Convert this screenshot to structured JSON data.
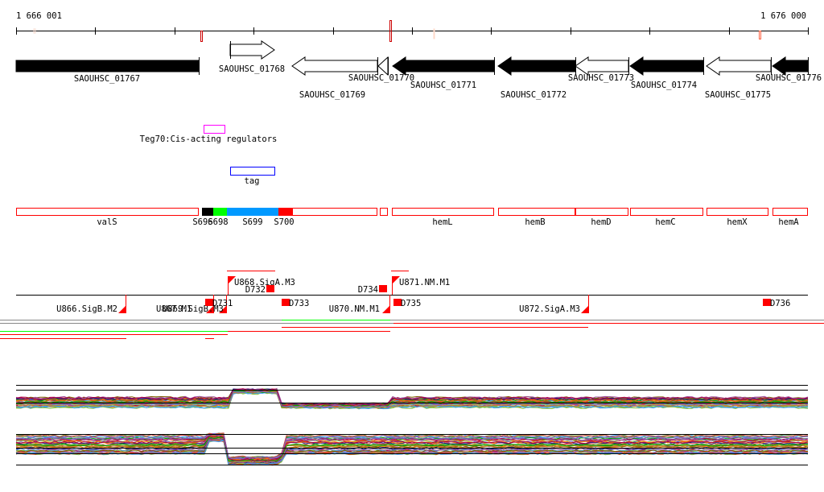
{
  "ruler": {
    "start_label": "1 666 001",
    "end_label": "1 676 000"
  },
  "genes": [
    {
      "label": "SAOUHSC_01767",
      "strand": "none",
      "fill": "filled"
    },
    {
      "label": "SAOUHSC_01768",
      "strand": "+",
      "fill": "outline"
    },
    {
      "label": "SAOUHSC_01769",
      "strand": "-",
      "fill": "outline"
    },
    {
      "label": "SAOUHSC_01770",
      "strand": "-",
      "fill": "outline"
    },
    {
      "label": "SAOUHSC_01771",
      "strand": "-",
      "fill": "filled"
    },
    {
      "label": "SAOUHSC_01772",
      "strand": "-",
      "fill": "filled"
    },
    {
      "label": "SAOUHSC_01773",
      "strand": "-",
      "fill": "outline"
    },
    {
      "label": "SAOUHSC_01774",
      "strand": "-",
      "fill": "filled"
    },
    {
      "label": "SAOUHSC_01775",
      "strand": "-",
      "fill": "outline"
    },
    {
      "label": "SAOUHSC_01776",
      "strand": "-",
      "fill": "filled"
    }
  ],
  "regulator": {
    "label": "Teg70:Cis-acting regulators",
    "color": "#ff00ff"
  },
  "tag": {
    "label": "tag",
    "color": "#0000ff"
  },
  "features": [
    {
      "label": "valS",
      "color": "#ff0000",
      "filled": false
    },
    {
      "label": "S696",
      "color": "#000000",
      "filled": true
    },
    {
      "label": "S698",
      "color": "#00ff00",
      "filled": true
    },
    {
      "label": "S699",
      "color": "#0099ff",
      "filled": true
    },
    {
      "label": "S700",
      "color": "#ff0000",
      "filled": true
    },
    {
      "label": "",
      "color": "#ff0000",
      "filled": false
    },
    {
      "label": "",
      "color": "#ff0000",
      "filled": false
    },
    {
      "label": "hemL",
      "color": "#ff0000",
      "filled": false
    },
    {
      "label": "hemB",
      "color": "#ff0000",
      "filled": false
    },
    {
      "label": "hemD",
      "color": "#ff0000",
      "filled": false
    },
    {
      "label": "hemC",
      "color": "#ff0000",
      "filled": false
    },
    {
      "label": "hemX",
      "color": "#ff0000",
      "filled": false
    },
    {
      "label": "hemA",
      "color": "#ff0000",
      "filled": false
    }
  ],
  "units": [
    {
      "label": "U866.SigB.M2"
    },
    {
      "label": "U867.M1"
    },
    {
      "label": "U869.SigB.M3"
    },
    {
      "label": "U868.SigA.M3"
    },
    {
      "label": "U870.NM.M1"
    },
    {
      "label": "U871.NM.M1"
    },
    {
      "label": "U872.SigA.M3"
    }
  ],
  "boxes": [
    {
      "label": "D731"
    },
    {
      "label": "D732"
    },
    {
      "label": "D733"
    },
    {
      "label": "D734"
    },
    {
      "label": "D735"
    },
    {
      "label": "D736"
    }
  ],
  "colors": {
    "accent": "#ff0000",
    "green": "#00ff00"
  }
}
